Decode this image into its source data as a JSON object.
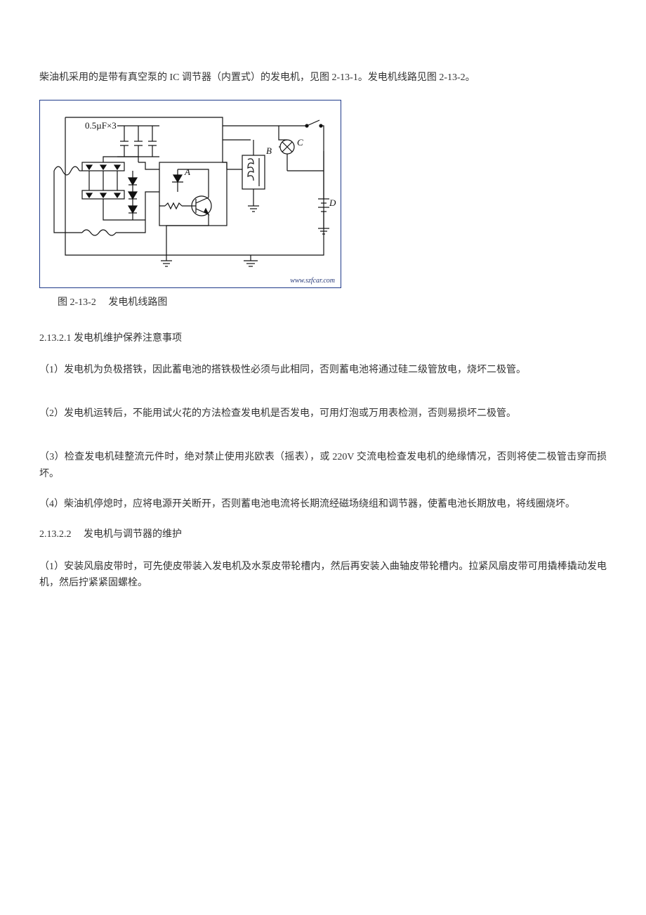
{
  "intro": "柴油机采用的是带有真空泵的 IC 调节器（内置式）的发电机，见图 2-13-1。发电机线路见图 2-13-2。",
  "figure": {
    "capacitor_label": "0.5µF×3",
    "labels": {
      "A": "A",
      "B": "B",
      "C": "C",
      "D": "D"
    },
    "watermark": "www.szfcar.com",
    "caption": "图 2-13-2　 发电机线路图"
  },
  "section1": {
    "heading": "2.13.2.1 发电机维护保养注意事项",
    "items": [
      "（1）发电机为负极搭铁，因此蓄电池的搭铁极性必须与此相同，否则蓄电池将通过硅二级管放电，烧坏二极管。",
      "（2）发电机运转后，不能用试火花的方法检查发电机是否发电，可用灯泡或万用表检测，否则易损坏二极管。",
      "（3）检查发电机硅整流元件时，绝对禁止使用兆欧表（摇表），或 220V 交流电检查发电机的绝缘情况，否则将使二极管击穿而损坏。",
      "（4）柴油机停熄时，应将电源开关断开，否则蓄电池电流将长期流经磁场绕组和调节器，使蓄电池长期放电，将线圈烧坏。"
    ]
  },
  "section2": {
    "heading": "2.13.2.2　 发电机与调节器的维护",
    "items": [
      "（1）安装风扇皮带时，可先使皮带装入发电机及水泵皮带轮槽内，然后再安装入曲轴皮带轮槽内。拉紧风扇皮带可用撬棒撬动发电机，然后拧紧紧固螺栓。"
    ]
  }
}
